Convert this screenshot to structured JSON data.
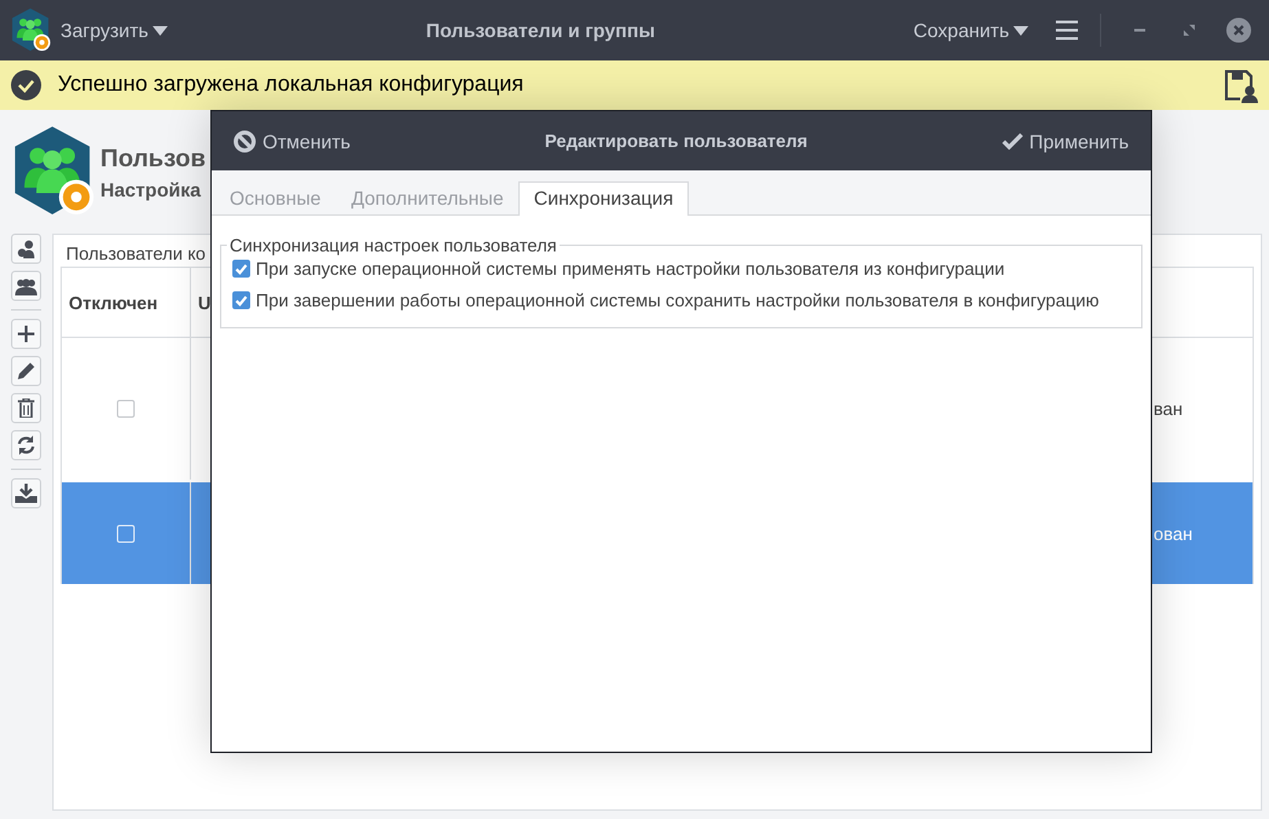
{
  "window": {
    "title": "Пользователи и группы"
  },
  "toolbar": {
    "load": "Загрузить",
    "save": "Сохранить"
  },
  "notification": {
    "text": "Успешно загружена локальная конфигурация"
  },
  "header": {
    "title": "Пользов",
    "subtitle": "Настройка"
  },
  "panel": {
    "tab": "Пользователи ко",
    "columns": [
      "Отключен",
      "U"
    ],
    "rows": [
      {
        "checked": false,
        "selected": false,
        "column_3": "ван"
      },
      {
        "checked": false,
        "selected": true,
        "column_3": "ован"
      }
    ]
  },
  "dialog": {
    "title": "Редактировать пользователя",
    "cancel": "Отменить",
    "apply": "Применить",
    "tabs": [
      {
        "label": "Основные",
        "selected": false
      },
      {
        "label": "Дополнительные",
        "selected": false
      },
      {
        "label": "Синхронизация",
        "selected": true
      }
    ],
    "group": {
      "title": "Синхронизация настроек пользователя",
      "options": [
        {
          "label": "При запуске операционной системы применять настройки пользователя из конфигурации",
          "checked": true
        },
        {
          "label": "При завершении работы операционной системы сохранить настройки пользователя в конфигурацию",
          "checked": true
        }
      ]
    }
  }
}
